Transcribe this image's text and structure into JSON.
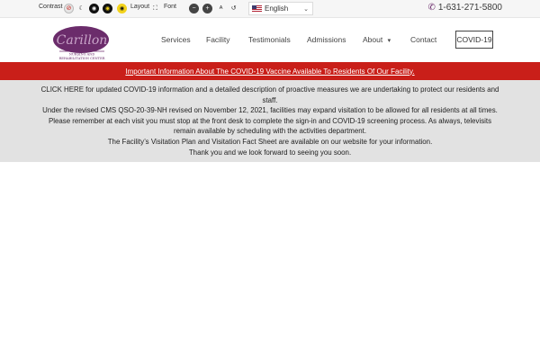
{
  "toolbar": {
    "contrast_label": "Contrast",
    "layout_label": "Layout",
    "font_label": "Font",
    "language": "English",
    "phone": "1-631-271-5800"
  },
  "nav": {
    "items": [
      "Services",
      "Facility",
      "Testimonials",
      "Admissions",
      "About",
      "Contact"
    ],
    "about_caret": "▾",
    "covid": "COVID-19"
  },
  "logo": {
    "name": "Carillon",
    "tagline_1": "NURSING AND",
    "tagline_2": "REHABILITATION CENTER"
  },
  "alert": {
    "link_text": "Important Information About The COVID-19 Vaccine Available To Residents Of Our Facility."
  },
  "notice": {
    "p1": "CLICK HERE for updated COVID-19 information and a detailed description of proactive measures we are undertaking to protect our residents and staff.",
    "p2": "Under the revised CMS QSO-20-39-NH revised on November 12, 2021, facilities may expand visitation to be allowed for all residents at all times. Please remember at each visit you must stop at the front desk to complete the sign-in and COVID-19 screening process. As always, televisits remain available by scheduling with the activities department.",
    "p3": "The Facility’s Visitation Plan and Visitation Fact Sheet are available on our website for your information.",
    "p4": "Thank you and we look forward to seeing you soon."
  },
  "colors": {
    "brand_purple": "#6b2c6b",
    "alert_red": "#c91f19",
    "notice_gray": "#e2e2e2"
  },
  "icons": {
    "contrast_reset": "circle-reset-icon",
    "dark_mode": "moon-icon",
    "contrast_dark": "eye-dark-icon",
    "contrast_light": "eye-yellow-icon",
    "layout": "expand-icon",
    "font_smaller": "minus-icon",
    "font_larger": "plus-icon",
    "font_size": "text-size-icon",
    "font_reset": "undo-icon",
    "phone": "phone-icon"
  }
}
